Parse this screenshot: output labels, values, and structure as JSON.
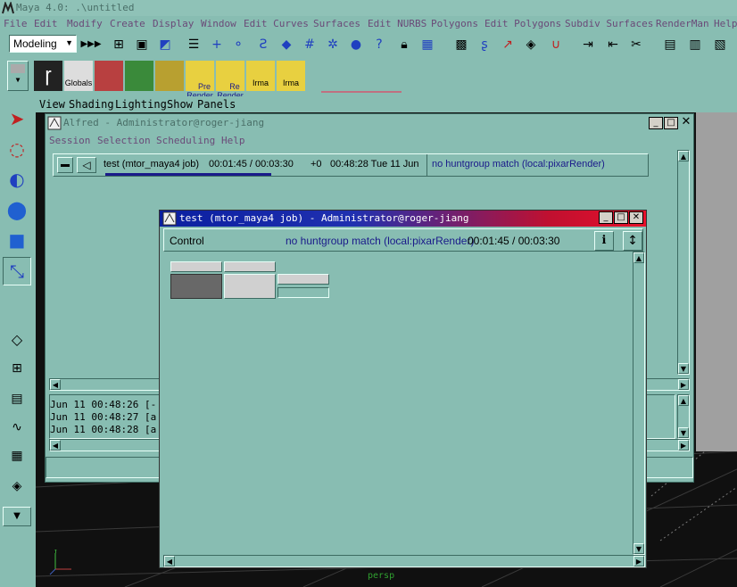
{
  "maya": {
    "title": "Maya 4.0: .\\untitled",
    "menus": [
      "File",
      "Edit",
      "Modify",
      "Create",
      "Display",
      "Window",
      "Edit Curves",
      "Surfaces",
      "Edit NURBS",
      "Polygons",
      "Edit Polygons",
      "Subdiv Surfaces",
      "RenderMan",
      "Help"
    ],
    "mode": "Modeling",
    "shelf": [
      {
        "label": "Globals"
      },
      {
        "label": "Pre\nRender"
      },
      {
        "label": "Re\nRender"
      },
      {
        "label": "Irma"
      },
      {
        "label": "Irma"
      }
    ],
    "panel_menu": [
      "View",
      "Shading",
      "Lighting",
      "Show",
      "Panels"
    ],
    "viewport_label": "persp"
  },
  "alfred": {
    "title": "Alfred - Administrator@roger-jiang",
    "menus": [
      "Session",
      "Selection",
      "Scheduling",
      "Help"
    ],
    "job": {
      "name": "test (mtor_maya4 job)",
      "elapsed": "00:01:45 / 00:03:30",
      "offset": "+0",
      "time": "00:48:28 Tue 11 Jun",
      "status": "no huntgroup match (local:pixarRender)",
      "progress": 0.5
    },
    "log": [
      "Jun 11 00:48:26 [-",
      "Jun 11 00:48:27 [a",
      "Jun 11 00:48:28 [a"
    ]
  },
  "test_window": {
    "title": "test (mtor_maya4 job) - Administrator@roger-jiang",
    "control_label": "Control",
    "status": "no huntgroup match (local:pixarRender)",
    "elapsed": "00:01:45 / 00:03:30"
  },
  "colors": {
    "bg": "#88bdb2",
    "title_gradient_start": "#0a1fa0",
    "title_gradient_end": "#e8102a",
    "status_text": "#1a1a8a"
  }
}
